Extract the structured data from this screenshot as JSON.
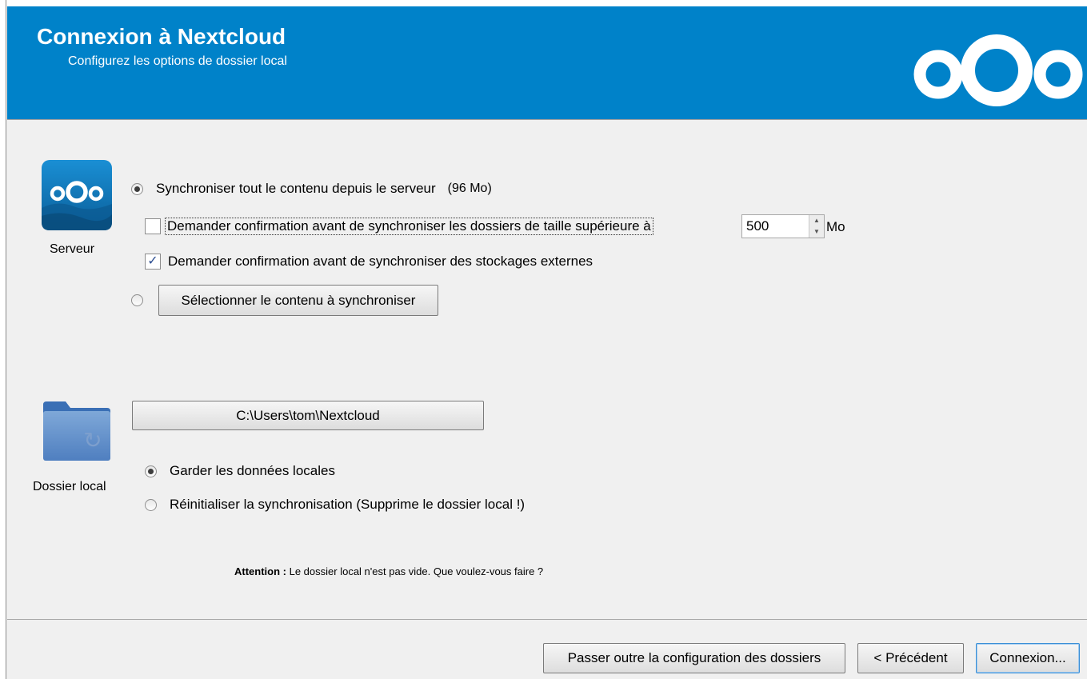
{
  "header": {
    "title": "Connexion à Nextcloud",
    "subtitle": "Configurez les options de dossier local",
    "brand_color": "#0082c9"
  },
  "server_section": {
    "icon": "nextcloud-server-icon",
    "label": "Serveur",
    "sync_all_label": "Synchroniser tout le contenu depuis le serveur",
    "sync_all_size": "(96 Mo)",
    "sync_all_selected": true,
    "ask_large_folders_label": "Demander confirmation avant de synchroniser les dossiers de taille supérieure à",
    "ask_large_folders_checked": false,
    "size_limit_value": "500",
    "size_limit_unit": "Mo",
    "ask_external_label": "Demander confirmation avant de synchroniser des stockages externes",
    "ask_external_checked": true,
    "select_content_button": "Sélectionner le contenu à synchroniser",
    "select_content_selected": false
  },
  "local_section": {
    "icon": "sync-folder-icon",
    "label": "Dossier local",
    "path_button": "C:\\Users\\tom\\Nextcloud",
    "keep_data_label": "Garder les données locales",
    "keep_data_selected": true,
    "reset_sync_label": "Réinitialiser la synchronisation (Supprime le dossier local !)",
    "reset_sync_selected": false
  },
  "warning": {
    "bold": "Attention :",
    "text": "Le dossier local n'est pas vide. Que voulez-vous faire ?"
  },
  "footer": {
    "skip_button": "Passer outre la configuration des dossiers",
    "back_button": "< Précédent",
    "connect_button": "Connexion..."
  }
}
